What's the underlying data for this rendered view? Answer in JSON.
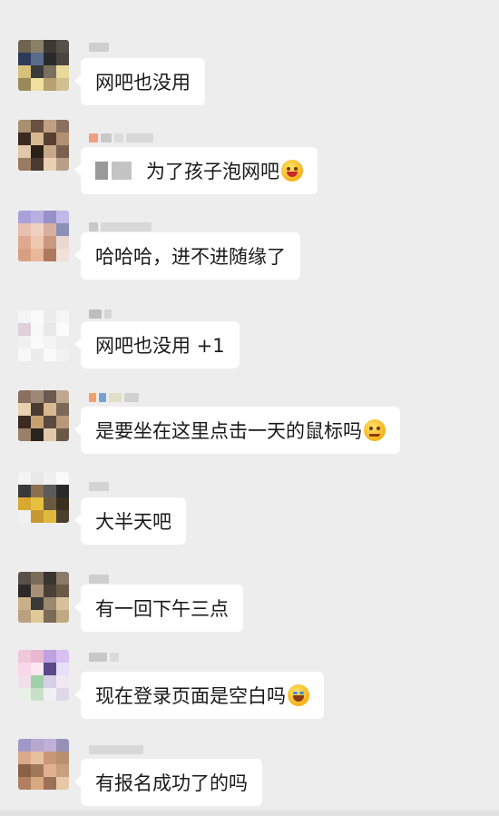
{
  "messages": [
    {
      "text": "网吧也没用",
      "emoji": null
    },
    {
      "text": "为了孩子泡网吧",
      "emoji": "tongue-wink-emoji"
    },
    {
      "text": "哈哈哈，进不进随缘了",
      "emoji": null
    },
    {
      "text": "网吧也没用 +1",
      "emoji": null
    },
    {
      "text": "是要坐在这里点击一天的鼠标吗",
      "emoji": "smirk-emoji"
    },
    {
      "text": "大半天吧",
      "emoji": null
    },
    {
      "text": "有一回下午三点",
      "emoji": null
    },
    {
      "text": "现在登录页面是空白吗",
      "emoji": "tears-of-joy-emoji"
    },
    {
      "text": "有报名成功了的吗",
      "emoji": null
    }
  ],
  "colors": {
    "background": "#ededed",
    "bubble": "#ffffff",
    "text": "#1a1a1a"
  }
}
